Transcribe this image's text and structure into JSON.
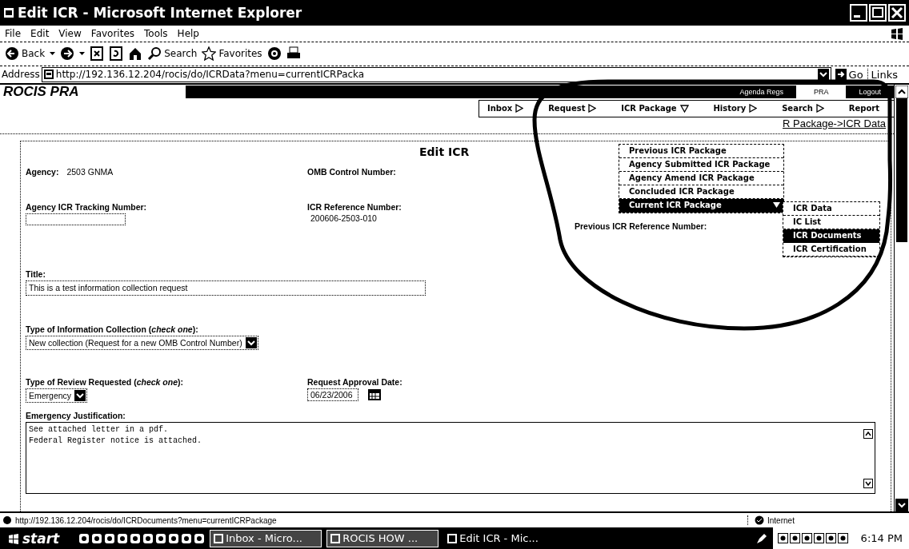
{
  "window": {
    "title": "Edit ICR - Microsoft Internet Explorer"
  },
  "menu_bar": [
    "File",
    "Edit",
    "View",
    "Favorites",
    "Tools",
    "Help"
  ],
  "toolbar": [
    {
      "kind": "back",
      "label": "Back"
    },
    {
      "kind": "forward"
    },
    {
      "kind": "stop"
    },
    {
      "kind": "refresh"
    },
    {
      "kind": "home"
    },
    {
      "kind": "search",
      "label": "Search"
    },
    {
      "kind": "favorites",
      "label": "Favorites"
    },
    {
      "kind": "media"
    },
    {
      "kind": "print"
    }
  ],
  "address_bar": {
    "label": "Address",
    "url": "http://192.136.12.204/rocis/do/ICRData?menu=currentICRPacka",
    "go": "Go",
    "links": "Links"
  },
  "app": {
    "title": "ROCIS PRA",
    "top_tabs": [
      {
        "label": "Agenda Regs",
        "selected": false
      },
      {
        "label": "PRA",
        "selected": true
      },
      {
        "label": "Logout",
        "selected": false
      }
    ],
    "nav": [
      {
        "label": "Inbox",
        "kind": "submenu",
        "expanded": false
      },
      {
        "label": "Request",
        "kind": "submenu",
        "expanded": false
      },
      {
        "label": "ICR Package",
        "kind": "submenu",
        "expanded": true
      },
      {
        "label": "History",
        "kind": "submenu",
        "expanded": false
      },
      {
        "label": "Search",
        "kind": "submenu",
        "expanded": false
      },
      {
        "label": "Report",
        "kind": "link"
      }
    ],
    "breadcrumb": "R Package->ICR Data",
    "dropdown": [
      {
        "label": "Previous ICR Package",
        "selected": false,
        "has_submenu": false
      },
      {
        "label": "Agency Submitted ICR Package",
        "selected": false,
        "has_submenu": false
      },
      {
        "label": "Agency Amend ICR Package",
        "selected": false,
        "has_submenu": false
      },
      {
        "label": "Concluded ICR Package",
        "selected": false,
        "has_submenu": false
      },
      {
        "label": "Current ICR Package",
        "selected": true,
        "has_submenu": true
      }
    ],
    "submenu": [
      {
        "label": "ICR Data",
        "selected": false
      },
      {
        "label": "IC List",
        "selected": false
      },
      {
        "label": "ICR Documents",
        "selected": true
      },
      {
        "label": "ICR Certification",
        "selected": false
      }
    ]
  },
  "form": {
    "heading": "Edit ICR",
    "agency": {
      "label": "Agency:",
      "value": "2503 GNMA"
    },
    "omb_control_number": {
      "label": "OMB Control Number:"
    },
    "tracking_number": {
      "label": "Agency ICR Tracking Number:"
    },
    "reference_number": {
      "label": "ICR Reference Number:",
      "value": "200606-2503-010"
    },
    "previous_reference_number": {
      "label": "Previous ICR Reference Number:"
    },
    "title": {
      "label": "Title:",
      "value": "This is a test information collection request"
    },
    "collection_type": {
      "label": "Type of Information Collection (*check one*):",
      "value": "New collection (Request for a new OMB Control Number)"
    },
    "review_type": {
      "label": "Type of Review Requested (*check one*):",
      "value": "Emergency"
    },
    "approval_date": {
      "label": "Request Approval Date:",
      "value": "06/23/2006"
    },
    "justification": {
      "label": "Emergency Justification:",
      "value": "See attached letter in a pdf.\nFederal Register notice is attached."
    }
  },
  "status_bar": {
    "url": "http://192.136.12.204/rocis/do/ICRDocuments?menu=currentICRPackage",
    "zone": "Internet"
  },
  "taskbar": {
    "start": "start",
    "tasks": [
      {
        "label": "Inbox - Micro...",
        "selected": false
      },
      {
        "label": "ROCIS HOW ...",
        "selected": false
      },
      {
        "label": "Edit ICR - Mic...",
        "selected": true
      }
    ],
    "clock": "6:14 PM"
  }
}
